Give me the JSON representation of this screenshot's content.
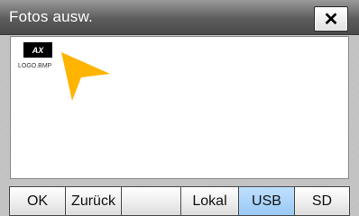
{
  "dialog": {
    "title": "Fotos ausw.",
    "close_label": "✕"
  },
  "files": [
    {
      "thumb_text": "AX",
      "name": "LOGO.BMP"
    }
  ],
  "toolbar": {
    "ok_label": "OK",
    "back_label": "Zurück",
    "local_label": "Lokal",
    "usb_label": "USB",
    "sd_label": "SD",
    "active_tab": "USB"
  },
  "colors": {
    "pointer": "#ffb400",
    "active_tab": "#9ac9f4"
  },
  "icons": {
    "pointer": "pointer-arrow-icon",
    "close": "close-icon"
  }
}
